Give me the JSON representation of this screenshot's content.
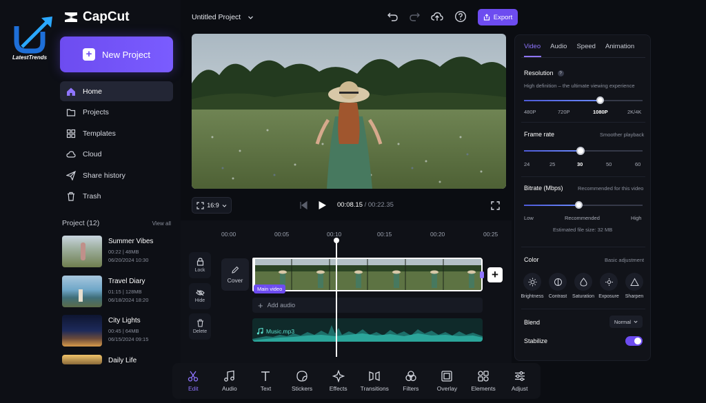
{
  "app": {
    "name": "CapCut"
  },
  "watermark": {
    "text": "LatestTrends"
  },
  "sidebar": {
    "new_project": "New Project",
    "nav": [
      {
        "label": "Home",
        "icon": "home-icon"
      },
      {
        "label": "Projects",
        "icon": "folder-icon"
      },
      {
        "label": "Templates",
        "icon": "grid-icon"
      },
      {
        "label": "Cloud",
        "icon": "cloud-icon"
      },
      {
        "label": "Share history",
        "icon": "send-icon"
      },
      {
        "label": "Trash",
        "icon": "trash-icon"
      }
    ],
    "projects_title": "Project (12)",
    "view_all": "View all",
    "projects": [
      {
        "name": "Summer Vibes",
        "meta1": "00:22 | 48MB",
        "meta2": "06/20/2024   10:30"
      },
      {
        "name": "Travel Diary",
        "meta1": "01:15 | 128MB",
        "meta2": "06/18/2024   18:20"
      },
      {
        "name": "City Lights",
        "meta1": "00:45 | 64MB",
        "meta2": "06/15/2024   09:15"
      },
      {
        "name": "Daily Life",
        "meta1": "",
        "meta2": ""
      }
    ]
  },
  "header": {
    "title": "Untitled Project",
    "export": "Export"
  },
  "player": {
    "ratio": "16:9",
    "current": "00:08.15",
    "total": " / 00:22.35"
  },
  "timeline": {
    "ruler": [
      "00:00",
      "00:05",
      "00:10",
      "00:15",
      "00:20",
      "00:25"
    ],
    "tools": [
      {
        "label": "Lock"
      },
      {
        "label": "Hide"
      },
      {
        "label": "Delete"
      }
    ],
    "cover": "Cover",
    "clip_tag": "Main video",
    "add_audio": "Add audio",
    "music": "Music.mp3"
  },
  "toolbar": [
    {
      "label": "Edit",
      "icon": "scissors-icon"
    },
    {
      "label": "Audio",
      "icon": "music-note-icon"
    },
    {
      "label": "Text",
      "icon": "text-icon"
    },
    {
      "label": "Stickers",
      "icon": "sticker-icon"
    },
    {
      "label": "Effects",
      "icon": "sparkle-icon"
    },
    {
      "label": "Transitions",
      "icon": "transition-icon"
    },
    {
      "label": "Filters",
      "icon": "filters-icon"
    },
    {
      "label": "Overlay",
      "icon": "overlay-icon"
    },
    {
      "label": "Elements",
      "icon": "elements-icon"
    },
    {
      "label": "Adjust",
      "icon": "sliders-icon"
    }
  ],
  "panel": {
    "tabs": [
      "Video",
      "Audio",
      "Speed",
      "Animation"
    ],
    "resolution": {
      "title": "Resolution",
      "sub": "High definition – the ultimate viewing experience",
      "ticks": [
        "480P",
        "720P",
        "1080P",
        "2K/4K"
      ],
      "selected": "1080P"
    },
    "frame_rate": {
      "title": "Frame rate",
      "hint": "Smoother playback",
      "ticks": [
        "24",
        "25",
        "30",
        "50",
        "60"
      ],
      "selected": "30"
    },
    "bitrate": {
      "title": "Bitrate (Mbps)",
      "hint": "Recommended for this video",
      "low": "Low",
      "rec": "Recommended",
      "high": "High",
      "est": "Estimated file size: 32 MB",
      "level": 0.5
    },
    "color": {
      "title": "Color",
      "hint": "Basic adjustment",
      "items": [
        {
          "label": "Brightness",
          "icon": "sun-icon"
        },
        {
          "label": "Contrast",
          "icon": "contrast-icon"
        },
        {
          "label": "Saturation",
          "icon": "drop-icon"
        },
        {
          "label": "Exposure",
          "icon": "exposure-icon"
        },
        {
          "label": "Sharpen",
          "icon": "triangle-icon"
        }
      ]
    },
    "blend": {
      "title": "Blend",
      "value": "Normal"
    },
    "stabilize": {
      "title": "Stabilize",
      "on": true
    }
  }
}
